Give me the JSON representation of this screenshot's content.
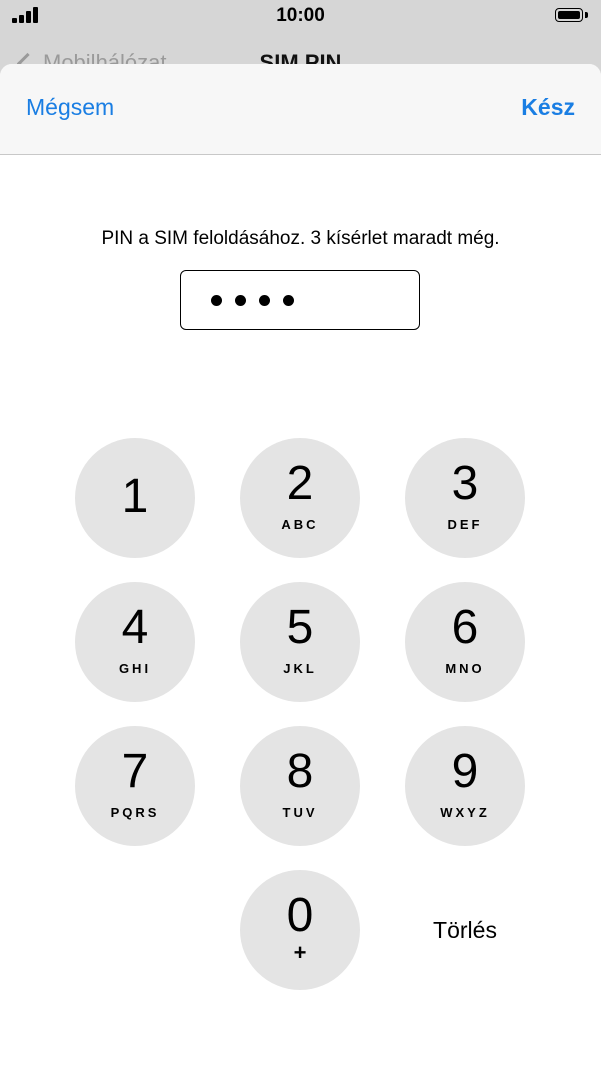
{
  "status_bar": {
    "time": "10:00",
    "signal_icon": "cellular-signal-icon",
    "battery_icon": "battery-full-icon"
  },
  "background_nav": {
    "back_label": "Mobilhálózat",
    "title": "SIM PIN"
  },
  "sheet": {
    "cancel_label": "Mégsem",
    "done_label": "Kész",
    "prompt": "PIN a SIM feloldásához. 3 kísérlet maradt még.",
    "pin_length_entered": 4
  },
  "keypad": {
    "keys": [
      {
        "digit": "1",
        "letters": ""
      },
      {
        "digit": "2",
        "letters": "ABC"
      },
      {
        "digit": "3",
        "letters": "DEF"
      },
      {
        "digit": "4",
        "letters": "GHI"
      },
      {
        "digit": "5",
        "letters": "JKL"
      },
      {
        "digit": "6",
        "letters": "MNO"
      },
      {
        "digit": "7",
        "letters": "PQRS"
      },
      {
        "digit": "8",
        "letters": "TUV"
      },
      {
        "digit": "9",
        "letters": "WXYZ"
      },
      {
        "digit": "0",
        "letters": "+"
      }
    ],
    "delete_label": "Törlés"
  },
  "colors": {
    "accent": "#1a7ee3",
    "key_background": "#e4e4e4",
    "backdrop": "#d6d6d6"
  }
}
